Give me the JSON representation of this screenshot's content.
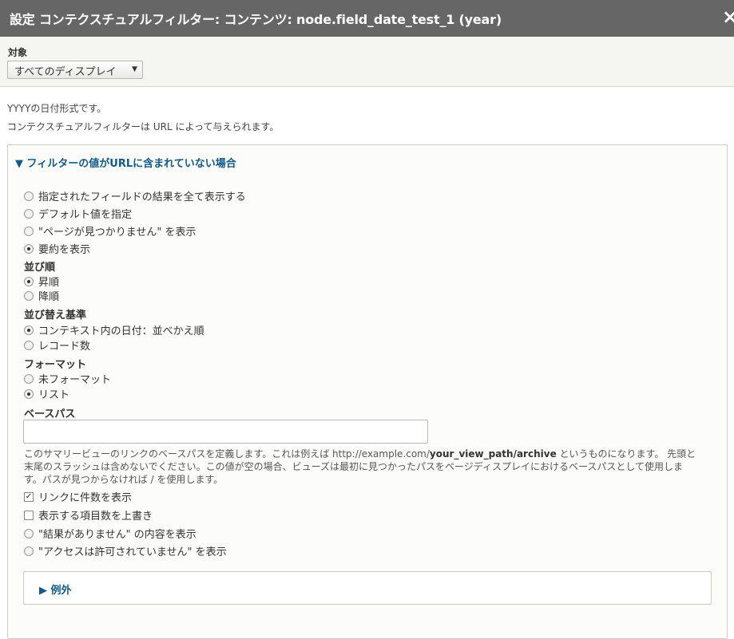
{
  "dialog": {
    "title": "設定 コンテクスチュアルフィルター: コンテンツ: node.field_date_test_1 (year)",
    "close_icon": "×"
  },
  "target": {
    "label": "対象",
    "select_value": "すべてのディスプレイ"
  },
  "description": {
    "line1": "YYYYの日付形式です。",
    "line2": "コンテクスチュアルフィルターは URL によって与えられます。"
  },
  "no_value": {
    "summary": "▼ フィルターの値がURLに含まれていない場合",
    "options": [
      {
        "label": "指定されたフィールドの結果を全て表示する",
        "checked": false
      },
      {
        "label": "デフォルト値を指定",
        "checked": false
      },
      {
        "label": "\"ページが見つかりません\" を表示",
        "checked": false
      },
      {
        "label": "要約を表示",
        "checked": true
      }
    ],
    "sort_order": {
      "heading": "並び順",
      "options": [
        {
          "label": "昇順",
          "checked": true
        },
        {
          "label": "降順",
          "checked": false
        }
      ]
    },
    "sort_by": {
      "heading": "並び替え基準",
      "options": [
        {
          "label": "コンテキスト内の日付：並べかえ順",
          "checked": true
        },
        {
          "label": "レコード数",
          "checked": false
        }
      ]
    },
    "format": {
      "heading": "フォーマット",
      "options": [
        {
          "label": "未フォーマット",
          "checked": false
        },
        {
          "label": "リスト",
          "checked": true
        }
      ]
    },
    "base_path": {
      "heading": "ベースパス",
      "value": "",
      "help_pre": "このサマリービューのリンクのベースパスを定義します。これは例えば http://example.com/",
      "help_bold": "your_view_path/archive",
      "help_post": " というものになります。 先頭と",
      "help_line2": "末尾のスラッシュは含めないでください。この値が空の場合、ビューズは最初に見つかったパスをページディスプレイにおけるベースパスとして使用しま",
      "help_line3": "す。パスが見つからなければ / を使用します。"
    },
    "checkboxes": [
      {
        "label": "リンクに件数を表示",
        "checked": true
      },
      {
        "label": "表示する項目数を上書き",
        "checked": false
      }
    ],
    "more_options": [
      {
        "label": "\"結果がありません\" の内容を表示",
        "checked": false
      },
      {
        "label": "\"アクセスは許可されていません\" を表示",
        "checked": false
      }
    ]
  },
  "exceptions": {
    "summary": "▶ 例外"
  },
  "colors": {
    "title_bar": "#666666",
    "link_blue": "#0f5a8a",
    "panel_bg": "#f5f5f2"
  }
}
